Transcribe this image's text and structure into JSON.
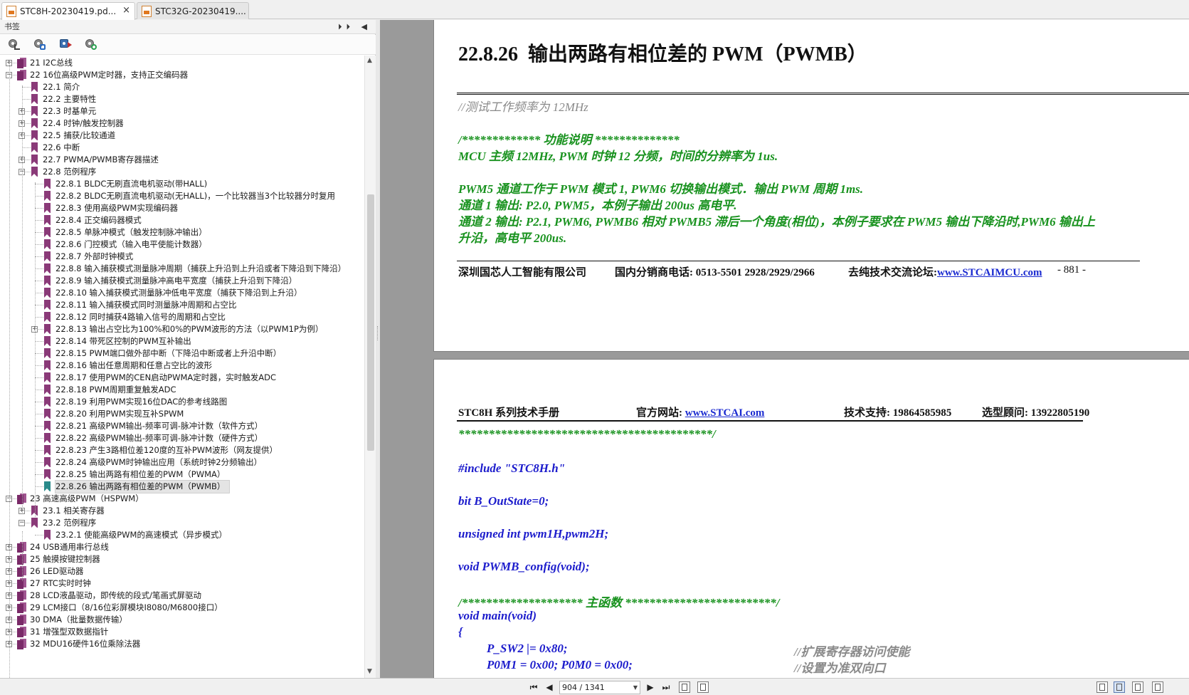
{
  "tabs": [
    {
      "label": "STC8H-20230419.pd...",
      "active": true,
      "close": "×"
    },
    {
      "label": "STC32G-20230419....",
      "active": false
    }
  ],
  "bookmarks_panel": {
    "title": "书签",
    "header_buttons": "⏵⏵ ◀",
    "tools": [
      "expand-all-icon",
      "collapse-all-icon",
      "bookmark-goto-icon",
      "bookmark-search-icon"
    ]
  },
  "tree": [
    {
      "label": "21 I2C总线",
      "level": 0,
      "exp": "+"
    },
    {
      "label": "22 16位高级PWM定时器，支持正交编码器",
      "level": 0,
      "exp": "-"
    },
    {
      "label": "22.1 简介",
      "level": 1,
      "exp": ""
    },
    {
      "label": "22.2 主要特性",
      "level": 1,
      "exp": ""
    },
    {
      "label": "22.3 时基单元",
      "level": 1,
      "exp": "+"
    },
    {
      "label": "22.4 时钟/触发控制器",
      "level": 1,
      "exp": "+"
    },
    {
      "label": "22.5 捕获/比较通道",
      "level": 1,
      "exp": "+"
    },
    {
      "label": "22.6 中断",
      "level": 1,
      "exp": ""
    },
    {
      "label": "22.7 PWMA/PWMB寄存器描述",
      "level": 1,
      "exp": "+"
    },
    {
      "label": "22.8 范例程序",
      "level": 1,
      "exp": "-"
    },
    {
      "label": "22.8.1 BLDC无刷直流电机驱动(带HALL)",
      "level": 2,
      "exp": ""
    },
    {
      "label": "22.8.2 BLDC无刷直流电机驱动(无HALL)，一个比较器当3个比较器分时复用",
      "level": 2,
      "exp": ""
    },
    {
      "label": "22.8.3 使用高级PWM实现编码器",
      "level": 2,
      "exp": ""
    },
    {
      "label": "22.8.4 正交编码器模式",
      "level": 2,
      "exp": ""
    },
    {
      "label": "22.8.5 单脉冲模式（触发控制脉冲输出）",
      "level": 2,
      "exp": ""
    },
    {
      "label": "22.8.6 门控模式（输入电平使能计数器）",
      "level": 2,
      "exp": ""
    },
    {
      "label": "22.8.7 外部时钟模式",
      "level": 2,
      "exp": ""
    },
    {
      "label": "22.8.8 输入捕获模式测量脉冲周期（捕获上升沿到上升沿或者下降沿到下降沿）",
      "level": 2,
      "exp": ""
    },
    {
      "label": "22.8.9 输入捕获模式测量脉冲高电平宽度（捕获上升沿到下降沿）",
      "level": 2,
      "exp": ""
    },
    {
      "label": "22.8.10 输入捕获模式测量脉冲低电平宽度（捕获下降沿到上升沿）",
      "level": 2,
      "exp": ""
    },
    {
      "label": "22.8.11 输入捕获模式同时测量脉冲周期和占空比",
      "level": 2,
      "exp": ""
    },
    {
      "label": "22.8.12 同时捕获4路输入信号的周期和占空比",
      "level": 2,
      "exp": ""
    },
    {
      "label": "22.8.13 输出占空比为100%和0%的PWM波形的方法（以PWM1P为例）",
      "level": 2,
      "exp": "+"
    },
    {
      "label": "22.8.14 带死区控制的PWM互补输出",
      "level": 2,
      "exp": ""
    },
    {
      "label": "22.8.15 PWM端口做外部中断（下降沿中断或者上升沿中断）",
      "level": 2,
      "exp": ""
    },
    {
      "label": "22.8.16 输出任意周期和任意占空比的波形",
      "level": 2,
      "exp": ""
    },
    {
      "label": "22.8.17 使用PWM的CEN启动PWMA定时器，实时触发ADC",
      "level": 2,
      "exp": ""
    },
    {
      "label": "22.8.18 PWM周期重复触发ADC",
      "level": 2,
      "exp": ""
    },
    {
      "label": "22.8.19 利用PWM实现16位DAC的参考线路图",
      "level": 2,
      "exp": ""
    },
    {
      "label": "22.8.20 利用PWM实现互补SPWM",
      "level": 2,
      "exp": ""
    },
    {
      "label": "22.8.21 高级PWM输出-频率可调-脉冲计数（软件方式）",
      "level": 2,
      "exp": ""
    },
    {
      "label": "22.8.22 高级PWM输出-频率可调-脉冲计数（硬件方式）",
      "level": 2,
      "exp": ""
    },
    {
      "label": "22.8.23 产生3路相位差120度的互补PWM波形（网友提供）",
      "level": 2,
      "exp": ""
    },
    {
      "label": "22.8.24 高级PWM时钟输出应用（系统时钟2分频输出）",
      "level": 2,
      "exp": ""
    },
    {
      "label": "22.8.25 输出两路有相位差的PWM（PWMA）",
      "level": 2,
      "exp": ""
    },
    {
      "label": "22.8.26 输出两路有相位差的PWM（PWMB）",
      "level": 2,
      "exp": "",
      "selected": true
    },
    {
      "label": "23 高速高级PWM（HSPWM）",
      "level": 0,
      "exp": "-"
    },
    {
      "label": "23.1 相关寄存器",
      "level": 1,
      "exp": "+"
    },
    {
      "label": "23.2 范例程序",
      "level": 1,
      "exp": "-"
    },
    {
      "label": "23.2.1 使能高级PWM的高速模式（异步模式）",
      "level": 2,
      "exp": ""
    },
    {
      "label": "24 USB通用串行总线",
      "level": 0,
      "exp": "+"
    },
    {
      "label": "25 触摸按键控制器",
      "level": 0,
      "exp": "+"
    },
    {
      "label": "26 LED驱动器",
      "level": 0,
      "exp": "+"
    },
    {
      "label": "27 RTC实时时钟",
      "level": 0,
      "exp": "+"
    },
    {
      "label": "28 LCD液晶驱动，即传统的段式/笔画式屏驱动",
      "level": 0,
      "exp": "+"
    },
    {
      "label": "29 LCM接口（8/16位彩屏模块I8080/M6800接口）",
      "level": 0,
      "exp": "+"
    },
    {
      "label": "30 DMA（批量数据传输）",
      "level": 0,
      "exp": "+"
    },
    {
      "label": "31 增强型双数据指针",
      "level": 0,
      "exp": "+"
    },
    {
      "label": "32 MDU16硬件16位乘除法器",
      "level": 0,
      "exp": "+"
    }
  ],
  "page1": {
    "heading_num": "22.8.26",
    "heading_text": "输出两路有相位差的 PWM（PWMB）",
    "lines": [
      {
        "cls": "grey",
        "text": "//测试工作频率为 12MHz"
      },
      {
        "cls": "green",
        "text": "/*************  功能说明  **************"
      },
      {
        "cls": "green",
        "text": "MCU 主频 12MHz, PWM 时钟 12 分频，时间的分辨率为 1us."
      },
      {
        "cls": "green",
        "text": "PWM5 通道工作于 PWM 模式 1, PWM6 切换输出模式．输出 PWM 周期 1ms."
      },
      {
        "cls": "green",
        "text": "通道 1 输出: P2.0, PWM5，本例子输出 200us 高电平."
      },
      {
        "cls": "green",
        "text": "通道 2 输出: P2.1, PWM6, PWMB6 相对 PWMB5 滞后一个角度(相位)，本例子要求在 PWM5 输出下降沿时,PWM6 输出上"
      },
      {
        "cls": "green",
        "text": "升沿，高电平 200us."
      }
    ],
    "footer": {
      "company": "深圳国芯人工智能有限公司",
      "phone": "国内分销商电话: 0513-5501 2928/2929/2966",
      "forum_label": "去纯技术交流论坛:",
      "forum_link": "www.STCAIMCU.com",
      "page_num": "- 881 -"
    }
  },
  "page2": {
    "header": {
      "manual": "STC8H 系列技术手册",
      "site_label": "官方网站: ",
      "site_link": "www.STCAI.com",
      "support": "技术支持: 19864585985",
      "consult": "选型顾问: 13922805190"
    },
    "lines": [
      {
        "cls": "green",
        "text": "******************************************/"
      },
      {
        "cls": "blue",
        "text": "#include \"STC8H.h\""
      },
      {
        "cls": "blue",
        "text": "bit B_OutState=0;"
      },
      {
        "cls": "blue",
        "text": "unsigned int pwm1H,pwm2H;"
      },
      {
        "cls": "blue",
        "text": "void PWMB_config(void);"
      },
      {
        "cls": "green",
        "text": "/********************  主函数  *************************/"
      },
      {
        "cls": "blue",
        "text": "void main(void)"
      },
      {
        "cls": "blue",
        "text": "{"
      },
      {
        "cls": "blue",
        "text": "P_SW2 |= 0x80;"
      },
      {
        "cls": "blue",
        "text": "P0M1 = 0x00; P0M0 = 0x00;"
      }
    ],
    "comments": [
      "//扩展寄存器访问使能",
      "//设置为准双向口"
    ]
  },
  "navbar": {
    "first": "⏮",
    "prev": "◀",
    "page_display": "904 / 1341",
    "dropdown": "▼",
    "next": "▶",
    "last": "⏭"
  }
}
